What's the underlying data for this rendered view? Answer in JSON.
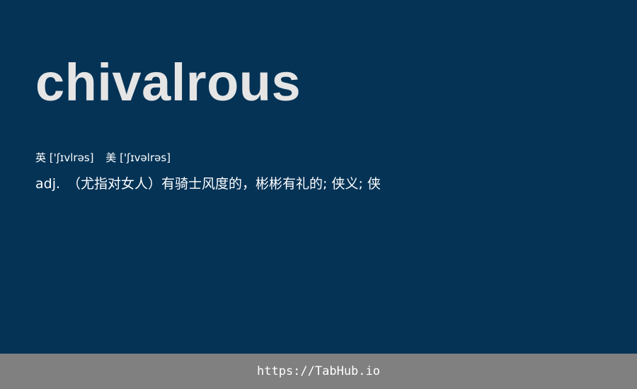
{
  "card": {
    "word": "chivalrous",
    "phonetics": {
      "uk_label": "英",
      "uk_ipa": "['ʃɪvlrəs]",
      "us_label": "美",
      "us_ipa": "['ʃɪvəlrəs]"
    },
    "definition": {
      "part_of_speech": "adj.",
      "text": "（尤指对女人）有骑士风度的，彬彬有礼的; 侠义; 侠"
    }
  },
  "footer": {
    "link_text": "https://TabHub.io"
  },
  "colors": {
    "background": "#043356",
    "word": "#e5e5e5",
    "text": "#ffffff",
    "footer_bar": "#808080"
  }
}
